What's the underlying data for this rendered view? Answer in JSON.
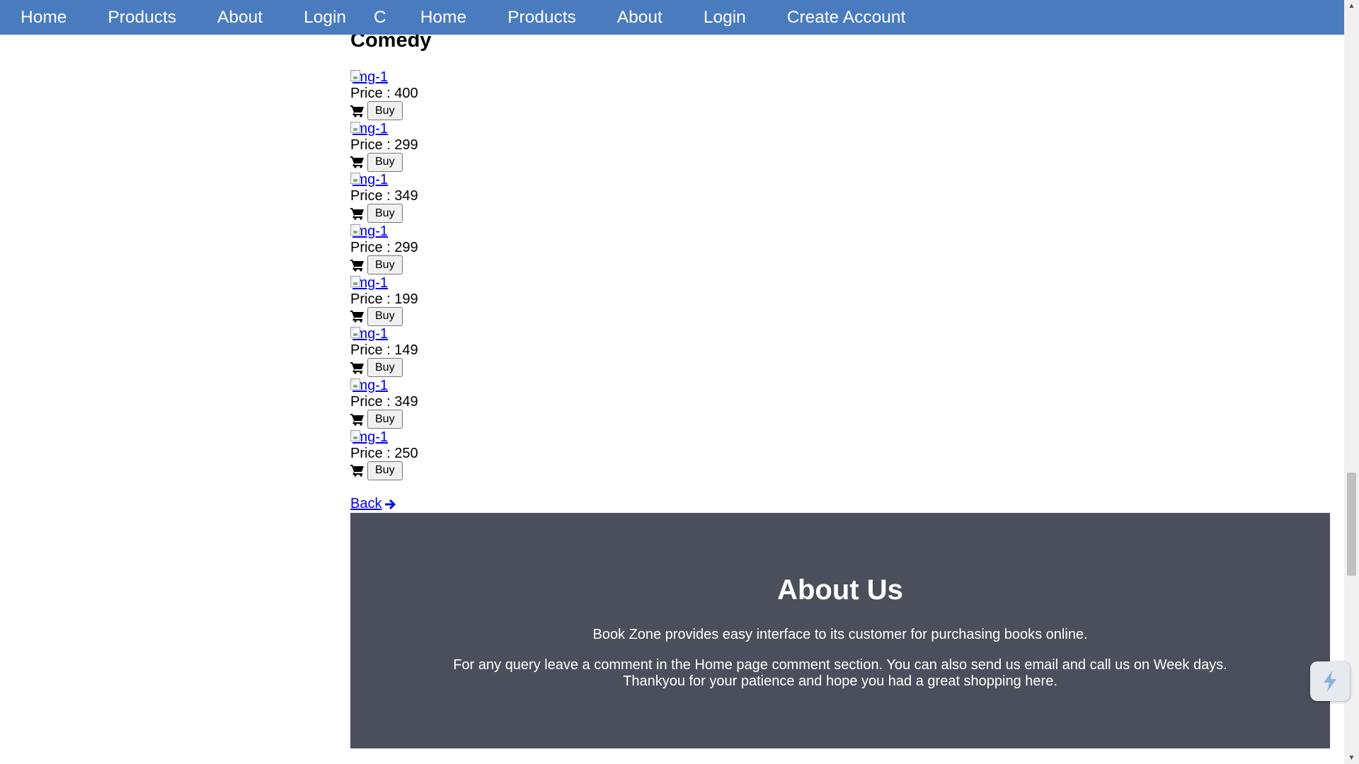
{
  "nav": {
    "items": [
      "Home",
      "Products",
      "About",
      "Login",
      "C",
      "Home",
      "Products",
      "About",
      "Login",
      "Create Account"
    ]
  },
  "category": {
    "heading": "Comedy"
  },
  "products": [
    {
      "img_alt": "img-1",
      "price_text": "Price : 400",
      "buy_label": "Buy"
    },
    {
      "img_alt": "img-1",
      "price_text": "Price : 299",
      "buy_label": "Buy"
    },
    {
      "img_alt": "img-1",
      "price_text": "Price : 349",
      "buy_label": "Buy"
    },
    {
      "img_alt": "img-1",
      "price_text": "Price : 299",
      "buy_label": "Buy"
    },
    {
      "img_alt": "img-1",
      "price_text": "Price : 199",
      "buy_label": "Buy"
    },
    {
      "img_alt": "img-1",
      "price_text": "Price : 149",
      "buy_label": "Buy"
    },
    {
      "img_alt": "img-1",
      "price_text": "Price : 349",
      "buy_label": "Buy"
    },
    {
      "img_alt": "img-1",
      "price_text": "Price : 250",
      "buy_label": "Buy"
    }
  ],
  "back": {
    "label": "Back",
    "icon": "arrow-right-icon"
  },
  "about": {
    "title": "About Us",
    "paragraph1": "Book Zone provides easy interface to its customer for purchasing books online.",
    "paragraph2": "For any query leave a comment in the Home page comment section. You can also send us email and call us on Week days. Thankyou for your patience and hope you had a great shopping here."
  },
  "icons": {
    "cart": "shopping-cart-icon",
    "widget": "lightning-icon"
  },
  "colors": {
    "navbar": "#4a7bbf",
    "about_bg": "#4a4f5b",
    "link": "#0000ee"
  }
}
